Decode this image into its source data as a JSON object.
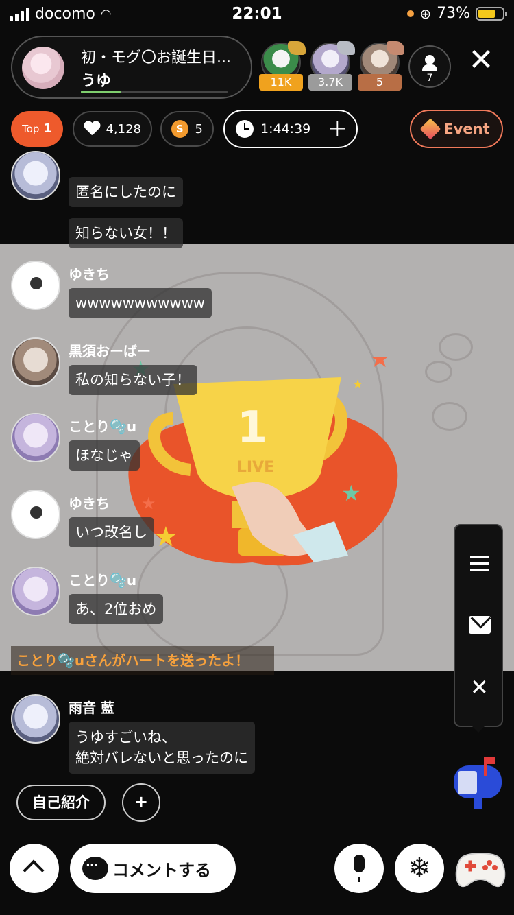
{
  "status_bar": {
    "carrier": "docomo",
    "time": "22:01",
    "battery": "73%"
  },
  "host": {
    "title": "初・モグ〇お誕生日...",
    "name": "うゆ",
    "progress": 0.27
  },
  "top_gifters": [
    {
      "label": "11K",
      "color": "#f0a21e"
    },
    {
      "label": "3.7K",
      "color": "#9b9b9b"
    },
    {
      "label": "5",
      "color": "#b86e45"
    }
  ],
  "viewer_count": "7",
  "stats": {
    "rank_prefix": "Top",
    "rank": "1",
    "hearts": "4,128",
    "coins": "5",
    "timer": "1:44:39",
    "event_label": "Event"
  },
  "comments": [
    {
      "name": "雨音 藍",
      "messages": [
        "匿名にしたのに",
        "知らない女！！"
      ]
    },
    {
      "name": "ゆきち",
      "messages": [
        "wwwwwwwwwww"
      ]
    },
    {
      "name": "黒須おーばー",
      "messages": [
        "私の知らない子！"
      ]
    },
    {
      "name": "ことり🫧u",
      "messages": [
        "ほなじゃ"
      ]
    },
    {
      "name": "ゆきち",
      "messages": [
        "いつ改名し"
      ]
    },
    {
      "name": "ことり🫧u",
      "messages": [
        "あ、2位おめ"
      ]
    }
  ],
  "notice": "ことり🫧uさんがハートを送ったよ！",
  "latest_comment": {
    "name": "雨音 藍",
    "lines": [
      "うゆすごいね、",
      "絶対バレないと思ったのに"
    ]
  },
  "trophy": {
    "rank": "1",
    "label": "LIVE"
  },
  "bottom": {
    "intro_label": "自己紹介",
    "add_label": "+",
    "comment_label": "コメントする"
  },
  "icons": {
    "close": "close-icon",
    "menu": "menu-icon",
    "mail": "mail-icon",
    "mic": "mic-icon",
    "snow": "snowflake-icon",
    "game": "gamepad-icon"
  }
}
